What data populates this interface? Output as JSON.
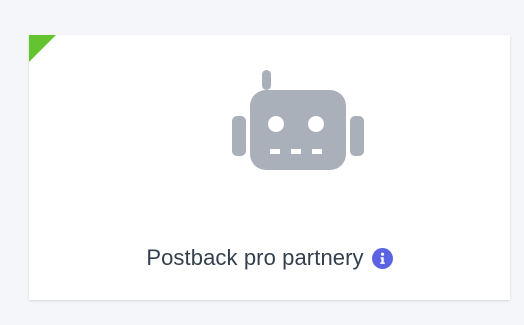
{
  "card": {
    "title": "Postback pro partnery",
    "icon": "robot-icon",
    "info_icon": "info-icon",
    "accent_color": "#64c42f",
    "icon_color": "#a9b0b9",
    "info_color": "#5b63e3"
  }
}
